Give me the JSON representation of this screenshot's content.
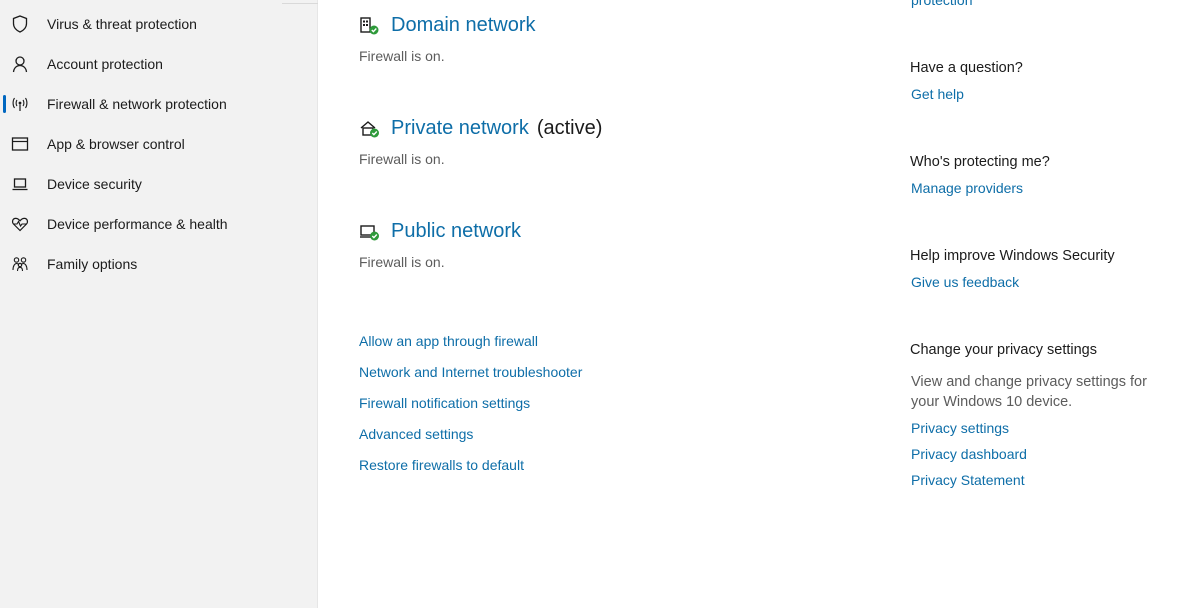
{
  "sidebar": {
    "items": [
      {
        "label": "Virus & threat protection",
        "icon": "shield-icon",
        "active": false
      },
      {
        "label": "Account protection",
        "icon": "person-icon",
        "active": false
      },
      {
        "label": "Firewall & network protection",
        "icon": "antenna-icon",
        "active": true
      },
      {
        "label": "App & browser control",
        "icon": "browser-window-icon",
        "active": false
      },
      {
        "label": "Device security",
        "icon": "laptop-icon",
        "active": false
      },
      {
        "label": "Device performance & health",
        "icon": "heart-pulse-icon",
        "active": false
      },
      {
        "label": "Family options",
        "icon": "family-icon",
        "active": false
      }
    ]
  },
  "networks": [
    {
      "title": "Domain network",
      "status": "Firewall is on.",
      "icon": "domain-network-icon"
    },
    {
      "title": "Private network",
      "active_label": "(active)",
      "status": "Firewall is on.",
      "icon": "private-network-icon"
    },
    {
      "title": "Public network",
      "status": "Firewall is on.",
      "icon": "public-network-icon"
    }
  ],
  "links": [
    "Allow an app through firewall",
    "Network and Internet troubleshooter",
    "Firewall notification settings",
    "Advanced settings",
    "Restore firewalls to default"
  ],
  "right": {
    "top_link_partial": "protection",
    "question_heading": "Have a question?",
    "get_help": "Get help",
    "protecting_heading": "Who's protecting me?",
    "manage_providers": "Manage providers",
    "improve_heading": "Help improve Windows Security",
    "feedback": "Give us feedback",
    "privacy_heading": "Change your privacy settings",
    "privacy_text": "View and change privacy settings for your Windows 10 device.",
    "privacy_settings": "Privacy settings",
    "privacy_dashboard": "Privacy dashboard",
    "privacy_statement": "Privacy Statement"
  },
  "colors": {
    "accent": "#0067c0",
    "link": "#0e6ea8",
    "ok_green": "#2e9a3a"
  }
}
